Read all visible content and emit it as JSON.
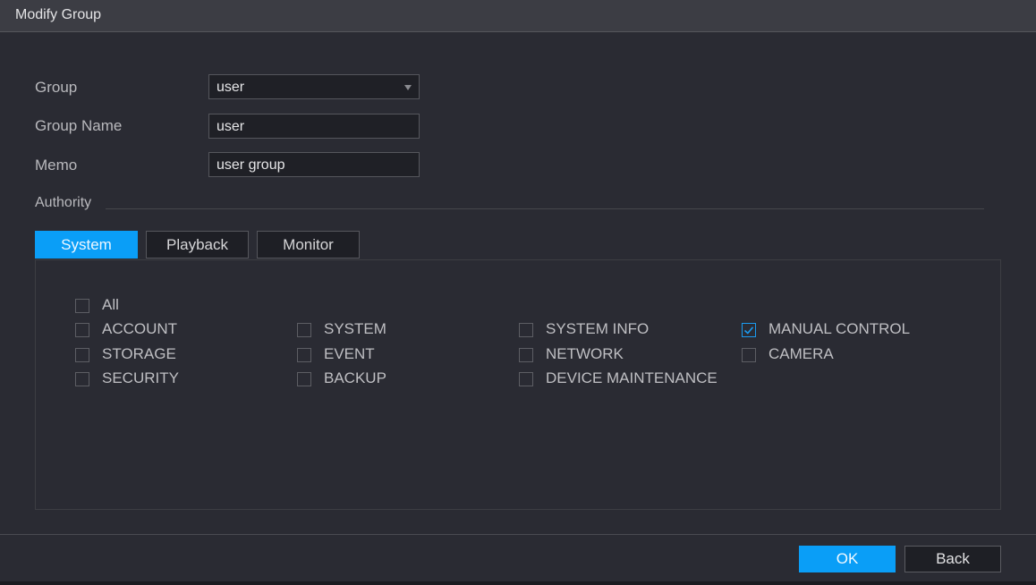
{
  "dialog": {
    "title": "Modify Group"
  },
  "form": {
    "group_label": "Group",
    "group_value": "user",
    "group_name_label": "Group Name",
    "group_name_value": "user",
    "memo_label": "Memo",
    "memo_value": "user group",
    "authority_label": "Authority"
  },
  "tabs": [
    {
      "label": "System",
      "active": true
    },
    {
      "label": "Playback",
      "active": false
    },
    {
      "label": "Monitor",
      "active": false
    }
  ],
  "permissions": {
    "all": {
      "label": "All",
      "checked": false
    },
    "items": [
      {
        "label": "ACCOUNT",
        "checked": false
      },
      {
        "label": "SYSTEM",
        "checked": false
      },
      {
        "label": "SYSTEM INFO",
        "checked": false
      },
      {
        "label": "MANUAL CONTROL",
        "checked": true
      },
      {
        "label": "STORAGE",
        "checked": false
      },
      {
        "label": "EVENT",
        "checked": false
      },
      {
        "label": "NETWORK",
        "checked": false
      },
      {
        "label": "CAMERA",
        "checked": false
      },
      {
        "label": "SECURITY",
        "checked": false
      },
      {
        "label": "BACKUP",
        "checked": false
      },
      {
        "label": "DEVICE MAINTENANCE",
        "checked": false
      }
    ]
  },
  "footer": {
    "ok_label": "OK",
    "back_label": "Back"
  },
  "colors": {
    "accent": "#0a9ef7",
    "background": "#2a2b33",
    "titlebar": "#3c3d44"
  },
  "icons": {
    "dropdown": "chevron-down-icon",
    "check": "checkmark-icon"
  }
}
